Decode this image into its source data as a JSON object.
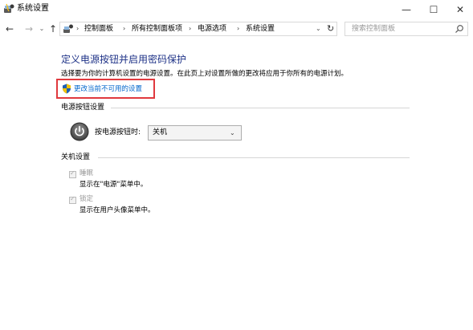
{
  "window": {
    "title": "系统设置",
    "minimize_label": "—",
    "maximize_label": "☐",
    "close_label": "✕"
  },
  "nav": {
    "back_glyph": "←",
    "forward_glyph": "→",
    "recent_glyph": "⌄",
    "up_glyph": "↑"
  },
  "breadcrumb": {
    "items": [
      "控制面板",
      "所有控制面板项",
      "电源选项",
      "系统设置"
    ],
    "separator": "›"
  },
  "search": {
    "placeholder": "搜索控制面板"
  },
  "page": {
    "title": "定义电源按钮并启用密码保护",
    "description": "选择要为你的计算机设置的电源设置。在此页上对设置所做的更改将应用于你所有的电源计划。",
    "change_link": "更改当前不可用的设置"
  },
  "power_section": {
    "heading": "电源按钮设置",
    "power_button_label": "按电源按钮时:",
    "power_button_value": "关机"
  },
  "shutdown_section": {
    "heading": "关机设置",
    "items": [
      {
        "label": "睡眠",
        "desc": "显示在\"电源\"菜单中。",
        "checked": true
      },
      {
        "label": "锁定",
        "desc": "显示在用户头像菜单中。",
        "checked": true
      }
    ]
  },
  "colors": {
    "title_blue": "#1e3287",
    "link_blue": "#0066cc",
    "highlight_red": "#e0393e"
  },
  "icons": {
    "app": "power-options-icon",
    "shield": "uac-shield-icon",
    "power": "power-button-icon",
    "search": "search-icon",
    "refresh": "refresh-icon"
  }
}
